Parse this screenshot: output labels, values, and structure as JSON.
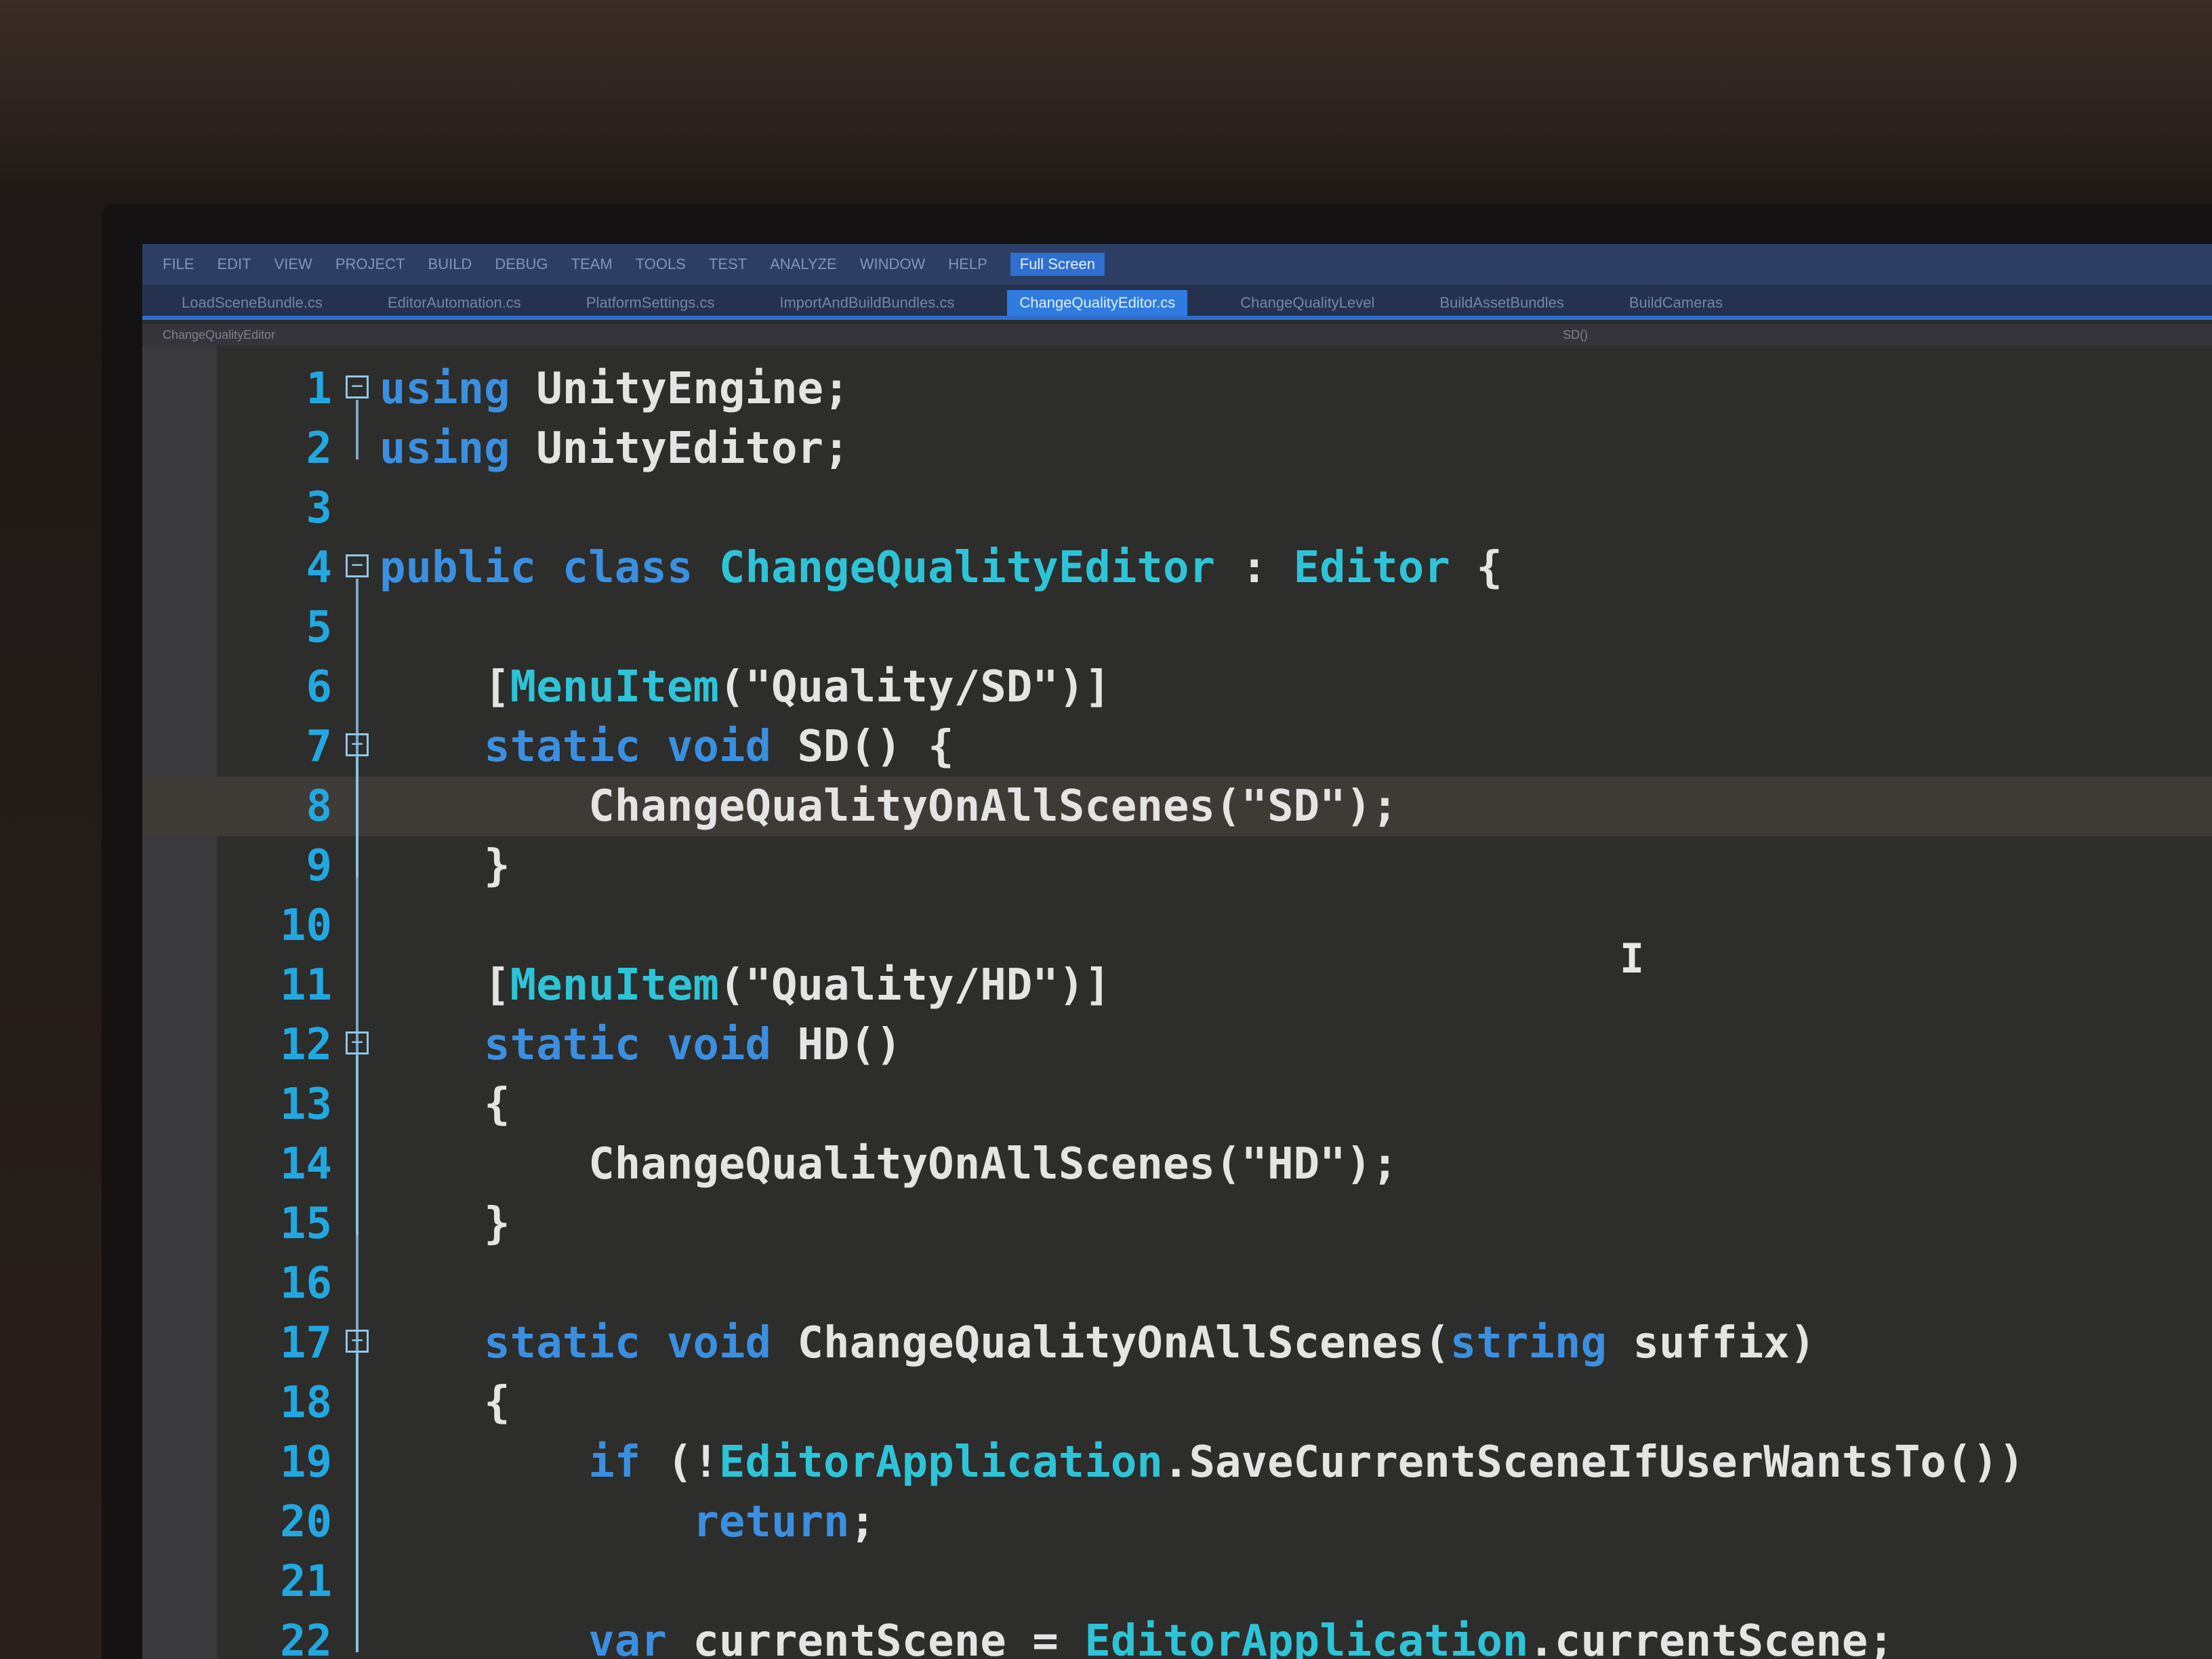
{
  "menubar": {
    "items": [
      "FILE",
      "EDIT",
      "VIEW",
      "PROJECT",
      "BUILD",
      "DEBUG",
      "TEAM",
      "TOOLS",
      "TEST",
      "ANALYZE",
      "WINDOW",
      "HELP"
    ],
    "active": "Full Screen"
  },
  "tabs": [
    {
      "label": "LoadSceneBundle.cs",
      "active": false
    },
    {
      "label": "EditorAutomation.cs",
      "active": false
    },
    {
      "label": "PlatformSettings.cs",
      "active": false
    },
    {
      "label": "ImportAndBuildBundles.cs",
      "active": false
    },
    {
      "label": "ChangeQualityEditor.cs",
      "active": true
    },
    {
      "label": "ChangeQualityLevel",
      "active": false
    },
    {
      "label": "BuildAssetBundles",
      "active": false
    },
    {
      "label": "BuildCameras",
      "active": false
    }
  ],
  "navbar": {
    "class_name": "ChangeQualityEditor",
    "member_name": "SD()"
  },
  "lines": [
    {
      "n": "1",
      "tokens": [
        {
          "t": "using ",
          "c": "kw"
        },
        {
          "t": "UnityEngine;",
          "c": "txt"
        }
      ]
    },
    {
      "n": "2",
      "tokens": [
        {
          "t": "using ",
          "c": "kw"
        },
        {
          "t": "UnityEditor;",
          "c": "txt"
        }
      ]
    },
    {
      "n": "3",
      "tokens": []
    },
    {
      "n": "4",
      "tokens": [
        {
          "t": "public ",
          "c": "kw"
        },
        {
          "t": "class ",
          "c": "kw"
        },
        {
          "t": "ChangeQualityEditor",
          "c": "ty"
        },
        {
          "t": " : ",
          "c": "txt"
        },
        {
          "t": "Editor",
          "c": "ty"
        },
        {
          "t": " {",
          "c": "txt"
        }
      ]
    },
    {
      "n": "5",
      "tokens": []
    },
    {
      "n": "6",
      "tokens": [
        {
          "t": "    [",
          "c": "txt"
        },
        {
          "t": "MenuItem",
          "c": "ty"
        },
        {
          "t": "(\"Quality/SD\")]",
          "c": "str"
        }
      ]
    },
    {
      "n": "7",
      "tokens": [
        {
          "t": "    static ",
          "c": "kw"
        },
        {
          "t": "void ",
          "c": "kw"
        },
        {
          "t": "SD() {",
          "c": "txt"
        }
      ]
    },
    {
      "n": "8",
      "tokens": [
        {
          "t": "        ChangeQualityOnAllScenes(\"SD\");",
          "c": "txt"
        }
      ]
    },
    {
      "n": "9",
      "tokens": [
        {
          "t": "    }",
          "c": "txt"
        }
      ]
    },
    {
      "n": "10",
      "tokens": []
    },
    {
      "n": "11",
      "tokens": [
        {
          "t": "    [",
          "c": "txt"
        },
        {
          "t": "MenuItem",
          "c": "ty"
        },
        {
          "t": "(\"Quality/HD\")]",
          "c": "str"
        }
      ]
    },
    {
      "n": "12",
      "tokens": [
        {
          "t": "    static ",
          "c": "kw"
        },
        {
          "t": "void ",
          "c": "kw"
        },
        {
          "t": "HD()",
          "c": "txt"
        }
      ]
    },
    {
      "n": "13",
      "tokens": [
        {
          "t": "    {",
          "c": "txt"
        }
      ]
    },
    {
      "n": "14",
      "tokens": [
        {
          "t": "        ChangeQualityOnAllScenes(\"HD\");",
          "c": "txt"
        }
      ]
    },
    {
      "n": "15",
      "tokens": [
        {
          "t": "    }",
          "c": "txt"
        }
      ]
    },
    {
      "n": "16",
      "tokens": []
    },
    {
      "n": "17",
      "tokens": [
        {
          "t": "    static ",
          "c": "kw"
        },
        {
          "t": "void ",
          "c": "kw"
        },
        {
          "t": "ChangeQualityOnAllScenes(",
          "c": "txt"
        },
        {
          "t": "string",
          "c": "kw"
        },
        {
          "t": " suffix)",
          "c": "txt"
        }
      ]
    },
    {
      "n": "18",
      "tokens": [
        {
          "t": "    {",
          "c": "txt"
        }
      ]
    },
    {
      "n": "19",
      "tokens": [
        {
          "t": "        if ",
          "c": "kw"
        },
        {
          "t": "(!",
          "c": "txt"
        },
        {
          "t": "EditorApplication",
          "c": "ty"
        },
        {
          "t": ".SaveCurrentSceneIfUserWantsTo())",
          "c": "txt"
        }
      ]
    },
    {
      "n": "20",
      "tokens": [
        {
          "t": "            return",
          "c": "kw"
        },
        {
          "t": ";",
          "c": "txt"
        }
      ]
    },
    {
      "n": "21",
      "tokens": []
    },
    {
      "n": "22",
      "tokens": [
        {
          "t": "        var ",
          "c": "kw"
        },
        {
          "t": "currentScene = ",
          "c": "txt"
        },
        {
          "t": "EditorApplication",
          "c": "ty"
        },
        {
          "t": ".currentScene;",
          "c": "txt"
        }
      ]
    }
  ],
  "current_line": "8",
  "colors": {
    "keyword": "#3b8fe0",
    "type": "#2ec4d8",
    "text": "#e4e4e4",
    "line_number": "#22a8e0",
    "accent": "#2f6fd0"
  }
}
